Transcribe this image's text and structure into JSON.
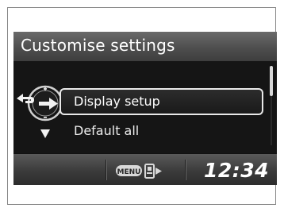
{
  "screen": {
    "title": "Customise settings",
    "menu_items": [
      {
        "label": "Display setup",
        "selected": true
      },
      {
        "label": "Default all",
        "selected": false
      }
    ],
    "selector_icons": [
      "back-arrow-icon",
      "dial-icon",
      "plus-icon",
      "minus-icon",
      "down-triangle-icon"
    ]
  },
  "status_bar": {
    "menu_button_label": "MENU",
    "clock": "12:34"
  },
  "colors": {
    "screen_bg": "#151515",
    "text": "#ffffff",
    "highlight_border": "#e8e8e8"
  }
}
